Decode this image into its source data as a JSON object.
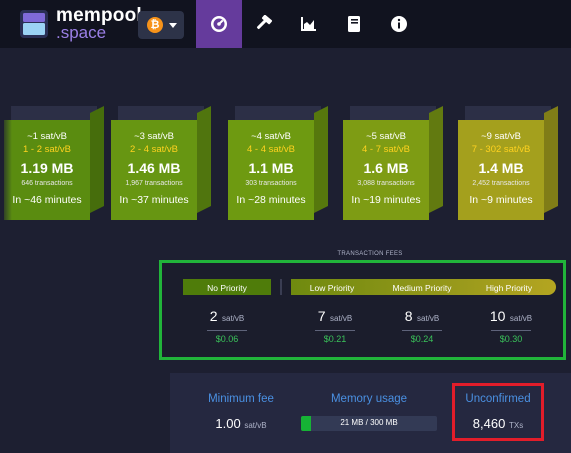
{
  "header": {
    "logo_line1": "mempool",
    "logo_line2": ".space",
    "network_symbol": "₿",
    "nav": [
      {
        "name": "dashboard",
        "icon": "dashboard-gauge-icon",
        "active": true
      },
      {
        "name": "mining",
        "icon": "hammer-icon",
        "active": false
      },
      {
        "name": "graphs",
        "icon": "area-chart-icon",
        "active": false
      },
      {
        "name": "docs",
        "icon": "book-icon",
        "active": false
      },
      {
        "name": "about",
        "icon": "info-icon",
        "active": false
      }
    ]
  },
  "blocks": [
    {
      "median_fee": "~1 sat/vB",
      "fee_range": "1 - 2 sat/vB",
      "size": "1.19 MB",
      "tx_count": "646 transactions",
      "eta": "In ~46 minutes",
      "color": "#5a8c10"
    },
    {
      "median_fee": "~3 sat/vB",
      "fee_range": "2 - 4 sat/vB",
      "size": "1.46 MB",
      "tx_count": "1,967 transactions",
      "eta": "In ~37 minutes",
      "color": "#679612"
    },
    {
      "median_fee": "~4 sat/vB",
      "fee_range": "4 - 4 sat/vB",
      "size": "1.1 MB",
      "tx_count": "303 transactions",
      "eta": "In ~28 minutes",
      "color": "#6e9a11"
    },
    {
      "median_fee": "~5 sat/vB",
      "fee_range": "4 - 7 sat/vB",
      "size": "1.6 MB",
      "tx_count": "3,088 transactions",
      "eta": "In ~19 minutes",
      "color": "#7e9c14"
    },
    {
      "median_fee": "~9 sat/vB",
      "fee_range": "7 - 302 sat/vB",
      "size": "1.4 MB",
      "tx_count": "2,452 transactions",
      "eta": "In ~9 minutes",
      "color": "#a4a01d"
    }
  ],
  "fees": {
    "title": "TRANSACTION FEES",
    "columns": [
      {
        "label": "No Priority",
        "value": "2",
        "unit": "sat/vB",
        "usd": "$0.06"
      },
      {
        "label": "Low Priority",
        "value": "7",
        "unit": "sat/vB",
        "usd": "$0.21"
      },
      {
        "label": "Medium Priority",
        "value": "8",
        "unit": "sat/vB",
        "usd": "$0.24"
      },
      {
        "label": "High Priority",
        "value": "10",
        "unit": "sat/vB",
        "usd": "$0.30"
      }
    ]
  },
  "stats": {
    "min_fee_label": "Minimum fee",
    "min_fee_value": "1.00",
    "min_fee_unit": "sat/vB",
    "memory_label": "Memory usage",
    "memory_text": "21 MB / 300 MB",
    "memory_fraction": 0.07,
    "unconfirmed_label": "Unconfirmed",
    "unconfirmed_value": "8,460",
    "unconfirmed_unit": "TXs"
  },
  "colors": {
    "accent": "#653b9c",
    "link_blue": "#4a90e2",
    "highlight_green": "#21b43a",
    "highlight_red": "#e21d2a"
  }
}
